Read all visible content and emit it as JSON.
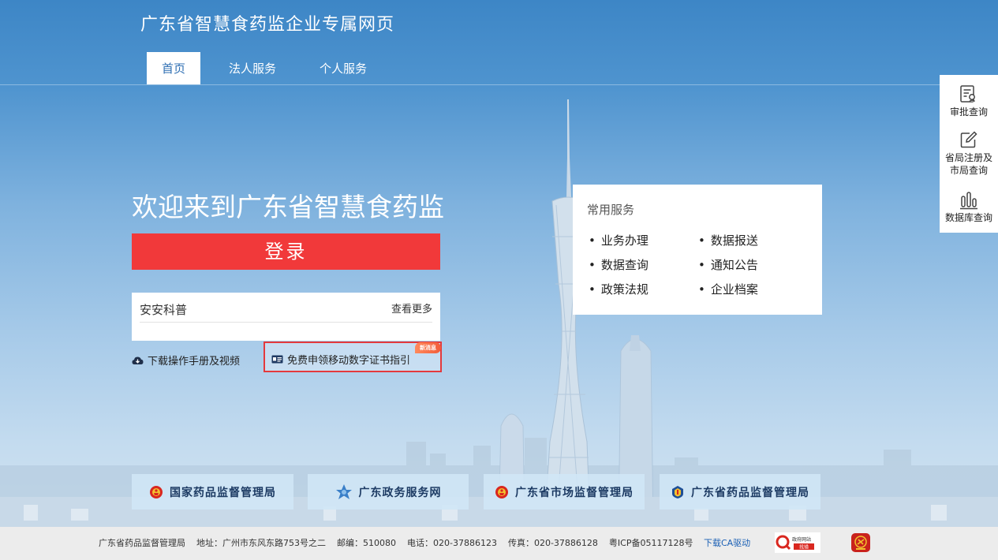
{
  "header": {
    "site_title": "广东省智慧食药监企业专属网页",
    "nav": [
      "首页",
      "法人服务",
      "个人服务"
    ]
  },
  "hero": {
    "welcome": "欢迎来到广东省智慧食药监",
    "login_label": "登录"
  },
  "news": {
    "title": "安安科普",
    "more_label": "查看更多"
  },
  "links": {
    "download_label": "下载操作手册及视频",
    "cert_label": "免费申领移动数字证书指引",
    "new_badge": "新消息"
  },
  "services": {
    "title": "常用服务",
    "items": [
      "业务办理",
      "数据报送",
      "数据查询",
      "通知公告",
      "政策法规",
      "企业档案"
    ]
  },
  "side_panel": {
    "items": [
      "审批查询",
      "省局注册及市局查询",
      "数据库查询"
    ],
    "line1": "省局注册及",
    "line2": "市局查询"
  },
  "bottom_links": [
    "国家药品监督管理局",
    "广东政务服务网",
    "广东省市场监督管理局",
    "广东省药品监督管理局"
  ],
  "footer": {
    "org": "广东省药品监督管理局",
    "address": "地址：广州市东风东路753号之二",
    "postcode": "邮编：510080",
    "phone": "电话：020-37886123",
    "fax": "传真：020-37886128",
    "icp": "粤ICP备05117128号",
    "ca_link": "下载CA驱动",
    "gov_badge_line1": "政府网站",
    "gov_badge_line2": "找错"
  },
  "colors": {
    "login_red": "#f1393a",
    "nav_active_text": "#2f6fb3",
    "highlight_border": "#e4393c"
  }
}
